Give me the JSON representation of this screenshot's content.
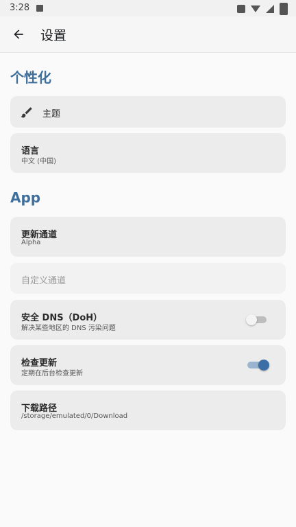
{
  "status_bar": {
    "time": "3:28"
  },
  "app_bar": {
    "title": "设置"
  },
  "sections": {
    "personalization": "个性化",
    "app": "App"
  },
  "items": {
    "theme": {
      "title": "主题"
    },
    "language": {
      "title": "语言",
      "subtitle": "中文 (中国)"
    },
    "update_channel": {
      "title": "更新通道",
      "subtitle": "Alpha"
    },
    "custom_channel": {
      "title": "自定义通道"
    },
    "secure_dns": {
      "title": "安全 DNS（DoH）",
      "subtitle": "解决某些地区的 DNS 污染问题",
      "enabled": false
    },
    "check_update": {
      "title": "检查更新",
      "subtitle": "定期在后台检查更新",
      "enabled": true
    },
    "download_path": {
      "title": "下载路径",
      "subtitle": "/storage/emulated/0/Download"
    }
  },
  "colors": {
    "accent": "#3f6f9b",
    "switch_on": "#3b6ea5",
    "card_bg": "#ececec"
  },
  "icons": {
    "back": "arrow-back-icon",
    "theme": "paint-brush-icon"
  }
}
